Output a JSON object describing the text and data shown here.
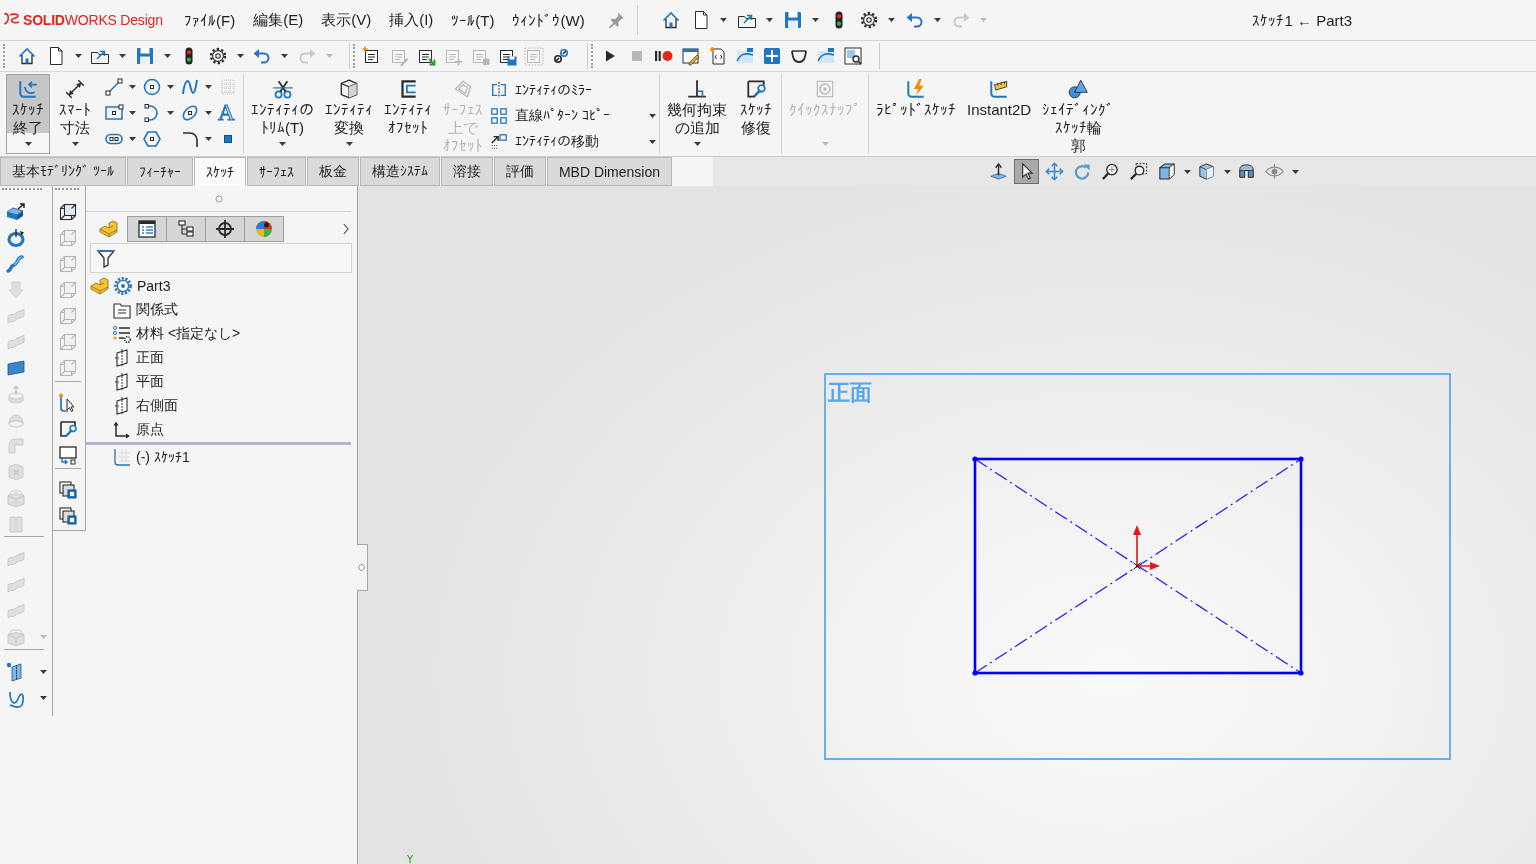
{
  "title_bar": {
    "logo": "**SOLID**WORKS Design",
    "menus": [
      "ﾌｧｲﾙ(F)",
      "編集(E)",
      "表示(V)",
      "挿入(I)",
      "ﾂｰﾙ(T)",
      "ｳｨﾝﾄﾞｳ(W)"
    ],
    "quick_access": [
      {
        "kind": "home",
        "dropdown": false,
        "disabled": false
      },
      {
        "kind": "new",
        "dropdown": true,
        "disabled": false
      },
      {
        "kind": "open",
        "dropdown": true,
        "disabled": false
      },
      {
        "kind": "save",
        "dropdown": true,
        "disabled": false
      },
      {
        "kind": "rebuild",
        "dropdown": false,
        "disabled": false
      },
      {
        "kind": "options",
        "dropdown": true,
        "disabled": false
      },
      {
        "kind": "undo",
        "dropdown": true,
        "disabled": false
      },
      {
        "kind": "redo",
        "dropdown": true,
        "disabled": true
      }
    ],
    "document_title": "ｽｹｯﾁ1 ← Part3"
  },
  "toolbar": {
    "groups": [
      [
        {
          "kind": "home",
          "dropdown": false,
          "disabled": false
        },
        {
          "kind": "new",
          "dropdown": true,
          "disabled": false
        },
        {
          "kind": "open",
          "dropdown": true,
          "disabled": false
        },
        {
          "kind": "save",
          "dropdown": true,
          "disabled": false
        },
        {
          "kind": "rebuild",
          "dropdown": false,
          "disabled": false
        },
        {
          "kind": "options",
          "dropdown": true,
          "disabled": false
        },
        {
          "kind": "undo",
          "dropdown": true,
          "disabled": false
        },
        {
          "kind": "redo",
          "dropdown": true,
          "disabled": true
        }
      ],
      [
        {
          "kind": "note-new",
          "dropdown": false,
          "disabled": false
        },
        {
          "kind": "note-edit",
          "dropdown": false,
          "disabled": true
        },
        {
          "kind": "note-arrow",
          "dropdown": false,
          "disabled": false
        },
        {
          "kind": "note-add",
          "dropdown": false,
          "disabled": true
        },
        {
          "kind": "note-lock",
          "dropdown": false,
          "disabled": true
        },
        {
          "kind": "note-save",
          "dropdown": false,
          "disabled": false
        },
        {
          "kind": "note-frame",
          "dropdown": false,
          "disabled": true
        },
        {
          "kind": "link",
          "dropdown": false,
          "disabled": false
        }
      ],
      [
        {
          "kind": "play",
          "dropdown": false,
          "disabled": false
        },
        {
          "kind": "stop",
          "dropdown": false,
          "disabled": true
        },
        {
          "kind": "pause-record",
          "dropdown": false,
          "disabled": false
        },
        {
          "kind": "macro-edit",
          "dropdown": false,
          "disabled": false
        },
        {
          "kind": "macro-new",
          "dropdown": false,
          "disabled": false
        },
        {
          "kind": "curve-tile",
          "dropdown": false,
          "disabled": false
        },
        {
          "kind": "cross-tile",
          "dropdown": false,
          "disabled": false
        },
        {
          "kind": "loop",
          "dropdown": false,
          "disabled": false
        },
        {
          "kind": "curve-tile",
          "dropdown": false,
          "disabled": false
        },
        {
          "kind": "frame-magnifier",
          "dropdown": false,
          "disabled": false
        }
      ]
    ]
  },
  "ribbon": {
    "sections": [
      {
        "buttons": [
          {
            "kind": "exit-sketch",
            "lines": [
              "ｽｹｯﾁ",
              "終了"
            ],
            "pressed": true,
            "disabled": false,
            "dropdown": true
          },
          {
            "kind": "smart-dimension",
            "lines": [
              "ｽﾏｰﾄ",
              "寸法"
            ],
            "pressed": false,
            "disabled": false,
            "dropdown": true
          }
        ],
        "grid": [
          {
            "kind": "line",
            "dropdown": true,
            "disabled": false
          },
          {
            "kind": "circle",
            "dropdown": true,
            "disabled": false
          },
          {
            "kind": "spline",
            "dropdown": true,
            "disabled": false
          },
          {
            "kind": "grid",
            "dropdown": false,
            "disabled": true
          },
          {
            "kind": "rectangle",
            "dropdown": true,
            "disabled": false
          },
          {
            "kind": "arc",
            "dropdown": true,
            "disabled": false
          },
          {
            "kind": "ellipse",
            "dropdown": true,
            "disabled": false
          },
          {
            "kind": "text",
            "glyph": "A",
            "dropdown": false,
            "disabled": false
          },
          {
            "kind": "slot",
            "dropdown": true,
            "disabled": false
          },
          {
            "kind": "polygon",
            "dropdown": false,
            "disabled": false
          },
          {
            "kind": "fillet",
            "dropdown": true,
            "disabled": false
          },
          {
            "kind": "point",
            "dropdown": false,
            "disabled": false
          }
        ]
      },
      {
        "buttons": [
          {
            "kind": "trim",
            "lines": [
              "ｴﾝﾃｨﾃｨの",
              "ﾄﾘﾑ(T)"
            ],
            "pressed": false,
            "disabled": false,
            "dropdown": true
          },
          {
            "kind": "convert",
            "lines": [
              "ｴﾝﾃｨﾃｨ",
              "変換"
            ],
            "pressed": false,
            "disabled": false,
            "dropdown": true
          },
          {
            "kind": "offset",
            "lines": [
              "ｴﾝﾃｨﾃｨ",
              "ｵﾌｾｯﾄ"
            ],
            "pressed": false,
            "disabled": false,
            "dropdown": false
          },
          {
            "kind": "surface-offset",
            "lines": [
              "ｻｰﾌｪｽ",
              "上で",
              "ｵﾌｾｯﾄ"
            ],
            "pressed": false,
            "disabled": true,
            "dropdown": false
          }
        ],
        "stack": [
          {
            "kind": "mirror",
            "label": "ｴﾝﾃｨﾃｨのﾐﾗｰ",
            "dropdown": false
          },
          {
            "kind": "linear-pattern",
            "label": "直線ﾊﾟﾀｰﾝ ｺﾋﾟｰ",
            "dropdown": true
          },
          {
            "kind": "move",
            "label": "ｴﾝﾃｨﾃｨの移動",
            "dropdown": true
          }
        ]
      },
      {
        "buttons": [
          {
            "kind": "add-relation",
            "lines": [
              "幾何拘束",
              "の追加"
            ],
            "pressed": false,
            "disabled": false,
            "dropdown": true
          },
          {
            "kind": "repair",
            "lines": [
              "ｽｹｯﾁ",
              "修復"
            ],
            "pressed": false,
            "disabled": false,
            "dropdown": false
          }
        ]
      },
      {
        "buttons": [
          {
            "kind": "quick-snaps",
            "lines": [
              "ｸｲｯｸｽﾅｯﾌﾟ"
            ],
            "pressed": false,
            "disabled": true,
            "dropdown": true
          }
        ]
      },
      {
        "buttons": [
          {
            "kind": "rapid-sketch",
            "lines": [
              "ﾗﾋﾟｯﾄﾞｽｹｯﾁ"
            ],
            "pressed": false,
            "disabled": false,
            "dropdown": false
          },
          {
            "kind": "instant2d",
            "lines": [
              "Instant2D"
            ],
            "pressed": false,
            "disabled": false,
            "dropdown": false
          },
          {
            "kind": "shaded-contours",
            "lines": [
              "ｼｪｲﾃﾞｨﾝｸﾞ",
              "ｽｹｯﾁ輪",
              "郭"
            ],
            "pressed": false,
            "disabled": false,
            "dropdown": false
          }
        ]
      }
    ]
  },
  "tabs": [
    {
      "label": "基本ﾓﾃﾞﾘﾝｸﾞ ﾂｰﾙ",
      "selected": false
    },
    {
      "label": "ﾌｨｰﾁｬｰ",
      "selected": false
    },
    {
      "label": "ｽｹｯﾁ",
      "selected": true
    },
    {
      "label": "ｻｰﾌｪｽ",
      "selected": false
    },
    {
      "label": "板金",
      "selected": false
    },
    {
      "label": "構造ｼｽﾃﾑ",
      "selected": false
    },
    {
      "label": "溶接",
      "selected": false
    },
    {
      "label": "評価",
      "selected": false
    },
    {
      "label": "MBD Dimension",
      "selected": false
    }
  ],
  "view_toolbar": [
    {
      "kind": "normal-to",
      "pressed": false,
      "dropdown": false
    },
    {
      "kind": "select",
      "pressed": true,
      "dropdown": false
    },
    {
      "kind": "pan",
      "pressed": false,
      "dropdown": false
    },
    {
      "kind": "rotate",
      "pressed": false,
      "dropdown": false
    },
    {
      "kind": "zoom",
      "pressed": false,
      "dropdown": false
    },
    {
      "kind": "zoom-area",
      "pressed": false,
      "dropdown": false
    },
    {
      "kind": "view-orientation",
      "pressed": false,
      "dropdown": true
    },
    {
      "kind": "display-style",
      "pressed": false,
      "dropdown": true
    },
    {
      "kind": "section",
      "pressed": false,
      "dropdown": false
    },
    {
      "kind": "hide-show",
      "pressed": false,
      "dropdown": true
    }
  ],
  "left_toolbars": {
    "features": [
      [
        {
          "kind": "extrude",
          "disabled": false,
          "dropdown": false
        },
        {
          "kind": "revolve",
          "disabled": false,
          "dropdown": false
        },
        {
          "kind": "sweep",
          "disabled": false,
          "dropdown": false
        },
        {
          "kind": "cut",
          "disabled": true,
          "dropdown": false
        },
        {
          "kind": "surface",
          "disabled": true,
          "dropdown": false
        },
        {
          "kind": "surface",
          "disabled": true,
          "dropdown": false
        },
        {
          "kind": "planar",
          "disabled": false,
          "dropdown": false
        },
        {
          "kind": "boss",
          "disabled": true,
          "dropdown": false
        },
        {
          "kind": "loft",
          "disabled": true,
          "dropdown": false
        },
        {
          "kind": "bend",
          "disabled": true,
          "dropdown": false
        },
        {
          "kind": "cube-x",
          "disabled": true,
          "dropdown": false
        },
        {
          "kind": "box",
          "disabled": true,
          "dropdown": false
        },
        {
          "kind": "zipper",
          "disabled": true,
          "dropdown": false
        }
      ],
      [
        {
          "kind": "surface",
          "disabled": true,
          "dropdown": false
        },
        {
          "kind": "surface",
          "disabled": true,
          "dropdown": false
        },
        {
          "kind": "surface",
          "disabled": true,
          "dropdown": false
        },
        {
          "kind": "box",
          "disabled": true,
          "dropdown": true
        }
      ],
      [
        {
          "kind": "plane-point",
          "disabled": false,
          "dropdown": true
        },
        {
          "kind": "curve",
          "disabled": false,
          "dropdown": true
        }
      ]
    ],
    "sketch_tools": [
      [
        {
          "kind": "view-cube",
          "disabled": false,
          "dropdown": false
        },
        {
          "kind": "view-cube",
          "disabled": true,
          "dropdown": false
        },
        {
          "kind": "view-cube",
          "disabled": true,
          "dropdown": false
        },
        {
          "kind": "view-cube",
          "disabled": true,
          "dropdown": false
        },
        {
          "kind": "view-cube",
          "disabled": true,
          "dropdown": false
        },
        {
          "kind": "view-cube",
          "disabled": true,
          "dropdown": false
        },
        {
          "kind": "view-cube",
          "disabled": true,
          "dropdown": false
        }
      ],
      [
        {
          "kind": "sketch-cursor",
          "disabled": false,
          "dropdown": false
        },
        {
          "kind": "repair",
          "disabled": false,
          "dropdown": false
        },
        {
          "kind": "screen-arrow",
          "disabled": false,
          "dropdown": false
        }
      ],
      [
        {
          "kind": "windows",
          "disabled": false,
          "dropdown": false
        },
        {
          "kind": "windows",
          "disabled": false,
          "dropdown": false
        }
      ]
    ]
  },
  "feature_manager": {
    "tabs": [
      {
        "kind": "feature-tree",
        "selected": true
      },
      {
        "kind": "property",
        "selected": false
      },
      {
        "kind": "configuration",
        "selected": false
      },
      {
        "kind": "dimxpert",
        "selected": false
      },
      {
        "kind": "display",
        "selected": false
      }
    ],
    "tree": {
      "kind": "part",
      "label": "Part3",
      "children": [
        {
          "kind": "equations",
          "label": "関係式"
        },
        {
          "kind": "material",
          "label": "材料 <指定なし>"
        },
        {
          "kind": "plane",
          "label": "正面"
        },
        {
          "kind": "plane",
          "label": "平面"
        },
        {
          "kind": "plane",
          "label": "右側面"
        },
        {
          "kind": "origin",
          "label": "原点"
        },
        {
          "kind": "rollback-bar"
        },
        {
          "kind": "sketch",
          "label": "(-) ｽｹｯﾁ1"
        }
      ]
    }
  },
  "graphics": {
    "plane_label": "正面",
    "triad_label": "Y"
  }
}
